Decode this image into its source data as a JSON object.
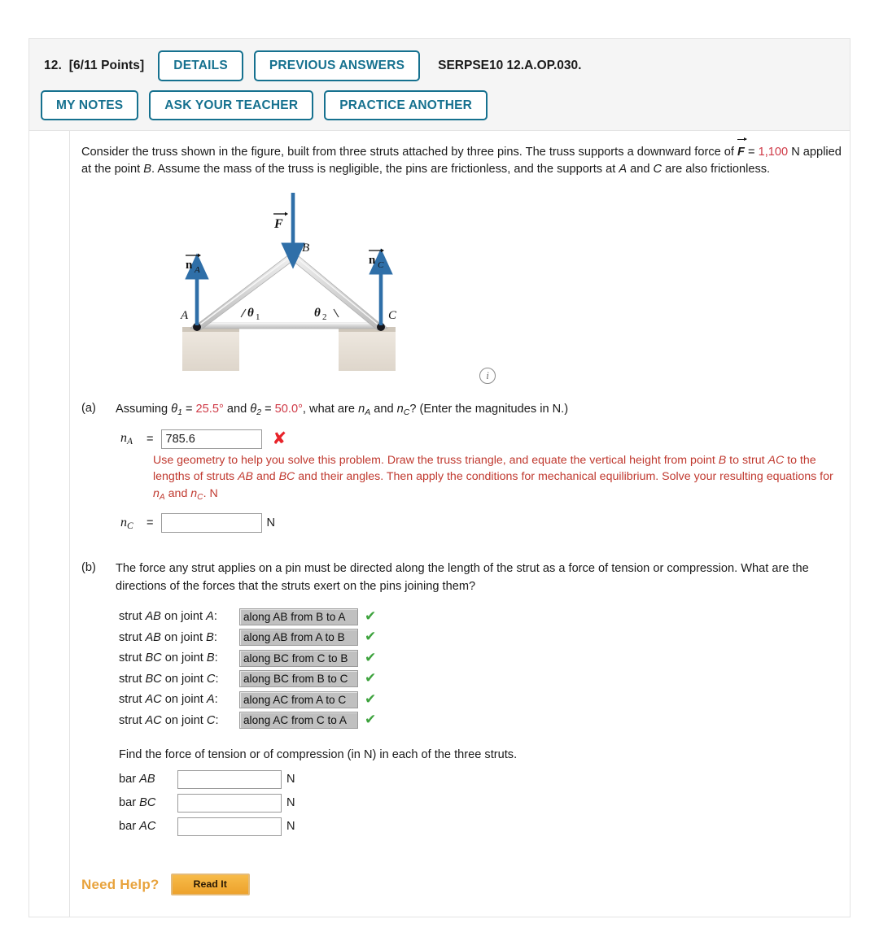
{
  "header": {
    "problem_number": "12.",
    "points": "[6/11 Points]",
    "details_label": "DETAILS",
    "previous_answers_label": "PREVIOUS ANSWERS",
    "reference_code": "SERPSE10 12.A.OP.030.",
    "my_notes_label": "MY NOTES",
    "ask_teacher_label": "ASK YOUR TEACHER",
    "practice_another_label": "PRACTICE ANOTHER"
  },
  "statement": {
    "line1_a": "Consider the truss shown in the figure, built from three struts attached by three pins. The truss supports a downward force of ",
    "force_symbol": "F",
    "equals": " = ",
    "force_value": "1,100",
    "force_unit": " N",
    "line2": " applied at the point B. Assume the mass of the truss is negligible, the pins are frictionless, and the supports at A and C are also frictionless."
  },
  "figure": {
    "label_A": "A",
    "label_B": "B",
    "label_C": "C",
    "label_F": "F",
    "label_nA": "n",
    "label_nA_sub": "A",
    "label_nC": "n",
    "label_nC_sub": "C",
    "label_theta1": "θ",
    "label_theta1_sub": "1",
    "label_theta2": "θ",
    "label_theta2_sub": "2",
    "info_icon": "i",
    "arrow_color": "#2f6fa8",
    "strut_color": "#d6d6d6",
    "ground_color": "#e8e2da"
  },
  "parts": {
    "a": {
      "marker": "(a)",
      "q_pre": "Assuming ",
      "theta1": "θ",
      "theta1_sub": "1",
      "theta1_eq": " = ",
      "theta1_value": "25.5°",
      "q_mid": " and ",
      "theta2": "θ",
      "theta2_sub": "2",
      "theta2_eq": " = ",
      "theta2_value": "50.0°",
      "q_post": ", what are n",
      "nA_sub": "A",
      "q_and": " and n",
      "nC_sub": "C",
      "q_end": "? (Enter the magnitudes in N.)",
      "nA_symbol": "n",
      "nA_symbol_sub": "A",
      "nA_equals": "=",
      "nA_value": "785.6",
      "nA_status": "incorrect",
      "nA_status_glyph": "✘",
      "nC_symbol": "n",
      "nC_symbol_sub": "C",
      "nC_equals": "=",
      "nC_value": "",
      "unit": "N",
      "feedback_1": "Use geometry to help you solve this problem. Draw the truss triangle, and equate the vertical height from point B to strut AC to the lengths of struts AB and BC and their angles. Then apply the conditions for mechanical equilibrium. Solve your resulting equations for ",
      "feedback_nA": "n",
      "feedback_nA_sub": "A",
      "feedback_mid": " and ",
      "feedback_nC": "n",
      "feedback_nC_sub": "C",
      "feedback_end": ". N"
    },
    "b": {
      "marker": "(b)",
      "question": "The force any strut applies on a pin must be directed along the length of the strut as a force of tension or compression. What are the directions of the forces that the struts exert on the pins joining them?",
      "rows": [
        {
          "label_pre": "strut ",
          "strut": "AB",
          "label_mid": " on joint ",
          "joint": "A",
          "label_end": ":",
          "value": "along AB from B to A",
          "status": "correct",
          "status_glyph": "✔"
        },
        {
          "label_pre": "strut ",
          "strut": "AB",
          "label_mid": " on joint ",
          "joint": "B",
          "label_end": ":",
          "value": "along AB from A to B",
          "status": "correct",
          "status_glyph": "✔"
        },
        {
          "label_pre": "strut ",
          "strut": "BC",
          "label_mid": " on joint ",
          "joint": "B",
          "label_end": ":",
          "value": "along BC from C to B",
          "status": "correct",
          "status_glyph": "✔"
        },
        {
          "label_pre": "strut ",
          "strut": "BC",
          "label_mid": " on joint ",
          "joint": "C",
          "label_end": ":",
          "value": "along BC from B to C",
          "status": "correct",
          "status_glyph": "✔"
        },
        {
          "label_pre": "strut ",
          "strut": "AC",
          "label_mid": " on joint ",
          "joint": "A",
          "label_end": ":",
          "value": "along AC from A to C",
          "status": "correct",
          "status_glyph": "✔"
        },
        {
          "label_pre": "strut ",
          "strut": "AC",
          "label_mid": " on joint ",
          "joint": "C",
          "label_end": ":",
          "value": "along AC from C to A",
          "status": "correct",
          "status_glyph": "✔"
        }
      ],
      "find_text": "Find the force of tension or of compression (in N) in each of the three struts.",
      "bars": [
        {
          "label_pre": "bar ",
          "bar": "AB",
          "value": "",
          "unit": "N"
        },
        {
          "label_pre": "bar ",
          "bar": "BC",
          "value": "",
          "unit": "N"
        },
        {
          "label_pre": "bar ",
          "bar": "AC",
          "value": "",
          "unit": "N"
        }
      ]
    }
  },
  "need_help": {
    "label": "Need Help?",
    "read_it_label": "Read It"
  },
  "colors": {
    "accent_teal": "#16718f",
    "red_value": "#cf3a47",
    "feedback_red": "#c0392f",
    "correct_green": "#3ea33e",
    "incorrect_red": "#e8232a",
    "help_orange": "#e8a33d"
  }
}
